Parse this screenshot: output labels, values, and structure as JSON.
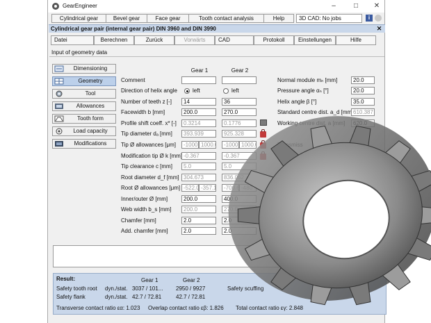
{
  "app_title": "GearEngineer",
  "window_controls": {
    "minimize": "–",
    "maximize": "□",
    "close": "✕"
  },
  "menu": [
    {
      "label": "Cylindrical gear"
    },
    {
      "label": "Bevel gear"
    },
    {
      "label": "Face gear"
    },
    {
      "label": "Tooth contact analysis"
    },
    {
      "label": "Help"
    }
  ],
  "cad_status": "3D CAD: No jobs",
  "info_label": "i",
  "subtitle": "Cylindrical gear pair (internal gear pair) DIN 3960 and DIN 3990",
  "close_glyph": "✕",
  "toolbar": [
    {
      "label": "Datei"
    },
    {
      "label": "Berechnen"
    },
    {
      "label": "Zurück"
    },
    {
      "label": "Vorwärts"
    },
    {
      "label": "CAD"
    },
    {
      "label": "Protokoll"
    },
    {
      "label": "Einstellungen"
    },
    {
      "label": "Hilfe"
    }
  ],
  "section_label": "Input of geometry data",
  "nav": [
    {
      "label": "Dimensioning"
    },
    {
      "label": "Geometry"
    },
    {
      "label": "Tool"
    },
    {
      "label": "Allowances"
    },
    {
      "label": "Tooth form"
    },
    {
      "label": "Load capacity"
    },
    {
      "label": "Modifications"
    }
  ],
  "columns": {
    "gear1": "Gear 1",
    "gear2": "Gear 2"
  },
  "rows": [
    {
      "label": "Comment",
      "g1": "",
      "g2": ""
    },
    {
      "label": "Direction of helix angle",
      "g1": "left",
      "g2": "left"
    },
    {
      "label": "Number of teeth z [-]",
      "g1": "14",
      "g2": "36"
    },
    {
      "label": "Facewidth b [mm]",
      "g1": "200.0",
      "g2": "270.0"
    },
    {
      "label": "Profile shift coeff. x* [-]",
      "g1": "0.3214",
      "g2": "0.1776"
    },
    {
      "label": "Tip diameter dₐ [mm]",
      "g1": "393.939",
      "g2": "925.328"
    },
    {
      "label": "Tip Ø allowances [μm]",
      "g1a": "-1000",
      "g1b": "1000.0",
      "g2a": "-1000",
      "g2b": "1000.0"
    },
    {
      "label": "Modification tip Ø k [mm]",
      "g1": "-0.367",
      "g2": "-0.367"
    },
    {
      "label": "Tip clearance c [mm]",
      "g1": "5.0",
      "g2": "5.0"
    },
    {
      "label": "Root diameter d_f [mm]",
      "g1": "304.673",
      "g2": "836.062"
    },
    {
      "label": "Root Ø allowances [μm]",
      "g1a": "-522.0",
      "g1b": "-357.1",
      "g2a": "-700.6",
      "g2b": "-480"
    },
    {
      "label": "Inner/outer Ø [mm]",
      "g1": "200.0",
      "g2": "400.0"
    },
    {
      "label": "Web width b_s [mm]",
      "g1": "200.0",
      "g2": "270.0"
    },
    {
      "label": "Chamfer [mm]",
      "g1": "2.0",
      "g2": "2.0"
    },
    {
      "label": "Add. chamfer [mm]",
      "g1": "2.0",
      "g2": "2.0"
    }
  ],
  "right_params": [
    {
      "label": "Normal module mₙ [mm]",
      "value": "20.0"
    },
    {
      "label": "Pressure angle αₙ [°]",
      "value": "20.0"
    },
    {
      "label": "Helix angle β [°]",
      "value": "35.0"
    },
    {
      "label": "Standard centre dist. a_d [mm]",
      "value": "610.387"
    },
    {
      "label": "Working centre dist. a [mm]",
      "value": "620.0"
    }
  ],
  "transmission_label": "Transmiss",
  "result": {
    "title": "Result:",
    "gear1": "Gear 1",
    "gear2": "Gear 2",
    "row1_label": "Safety tooth root",
    "row1_unit": "dyn./stat.",
    "row1_g1": "3037  / 101...",
    "row1_g2": "2950  / 9927",
    "row1_extra": "Safety scuffing",
    "row2_label": "Safety flank",
    "row2_unit": "dyn./stat.",
    "row2_g1": "42.7   / 72.81",
    "row2_g2": "42.7   / 72.81",
    "transverse": "Transverse contact ratio εα: 1.023",
    "overlap": "Overlap contact ratio εβ: 1.826",
    "total": "Total contact ratio εγ: 2.848"
  }
}
